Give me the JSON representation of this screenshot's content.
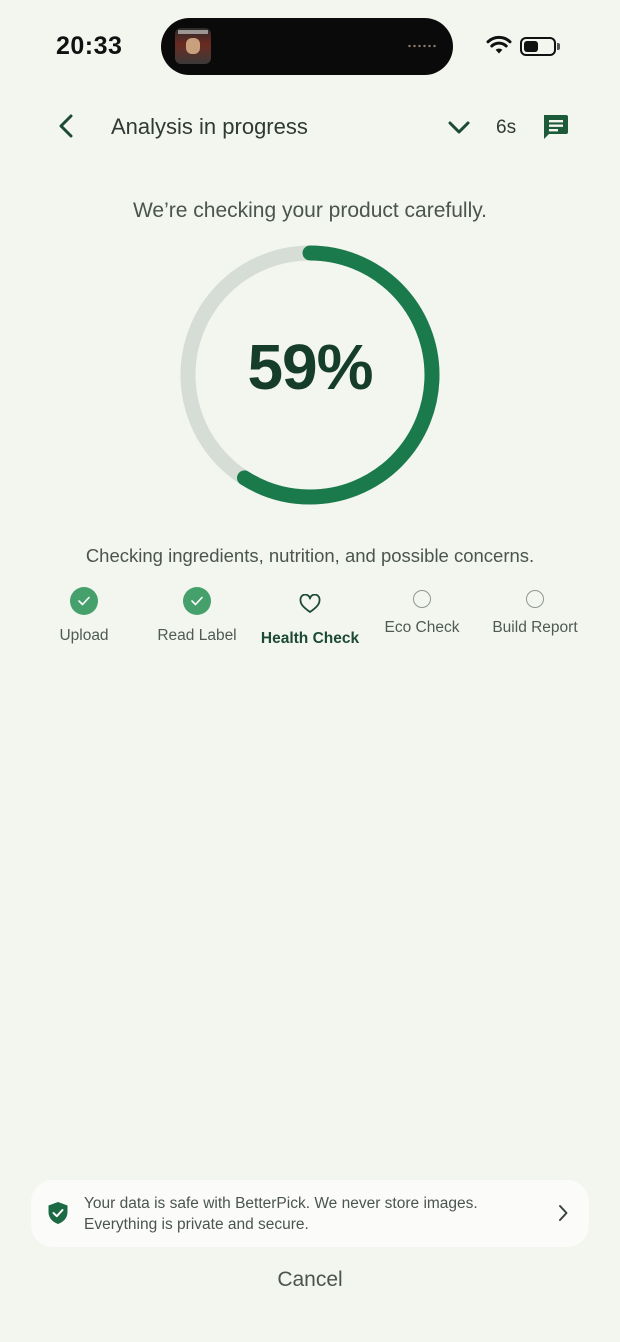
{
  "status_bar": {
    "time": "20:33",
    "battery_level": 0.5
  },
  "header": {
    "title": "Analysis in progress",
    "timer": "6s",
    "back_icon": "chevron-left-icon",
    "collapse_icon": "chevron-down-icon",
    "chat_icon": "chat-bubble-icon"
  },
  "main": {
    "subtitle": "We’re checking your product carefully.",
    "progress": {
      "percent_label": "59%",
      "value": 59
    },
    "status_text": "Checking ingredients, nutrition, and possible concerns."
  },
  "steps": [
    {
      "label": "Upload",
      "state": "done"
    },
    {
      "label": "Read Label",
      "state": "done"
    },
    {
      "label": "Health Check",
      "state": "active"
    },
    {
      "label": "Eco Check",
      "state": "pending"
    },
    {
      "label": "Build Report",
      "state": "pending"
    }
  ],
  "privacy": {
    "line1": "Your data is safe with BetterPick. We never store images.",
    "line2": "Everything is private and secure."
  },
  "footer": {
    "cancel_label": "Cancel"
  },
  "colors": {
    "background": "#f3f6ef",
    "accent": "#1b7a4c",
    "track": "#d6ddd6",
    "done": "#45a06b",
    "dark_green": "#153d2a"
  }
}
